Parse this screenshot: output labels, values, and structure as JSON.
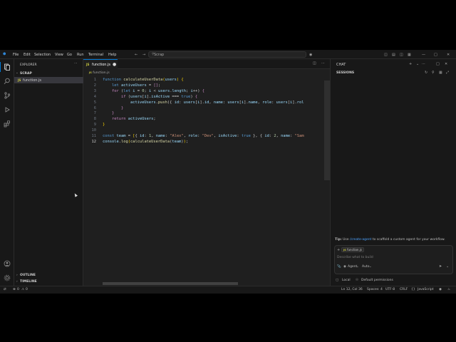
{
  "menu": {
    "file": "File",
    "edit": "Edit",
    "selection": "Selection",
    "view": "View",
    "go": "Go",
    "run": "Run",
    "terminal": "Terminal",
    "help": "Help"
  },
  "search_label": "Scrap",
  "explorer": {
    "title": "EXPLORER",
    "folder": "SCRAP",
    "file": "function.js",
    "outline": "OUTLINE",
    "timeline": "TIMELINE"
  },
  "editor": {
    "tab": "function.js",
    "breadcrumb": "function.js",
    "code_lines": [
      "1",
      "2",
      "3",
      "4",
      "5",
      "6",
      "7",
      "8",
      "9",
      "10",
      "11",
      "12"
    ]
  },
  "chat": {
    "title": "CHAT",
    "sessions": "SESSIONS",
    "tip_label": "Tip:",
    "tip_prefix": "Use",
    "tip_command": "/create-agent",
    "tip_suffix": "to scaffold a custom agent for your workflow.",
    "context_file": "function.js",
    "placeholder": "Describe what to build",
    "agent": "Agent",
    "auto": "Auto",
    "local": "Local",
    "permissions": "Default permissions"
  },
  "status": {
    "errors": "0",
    "warnings": "0",
    "position": "Ln 12, Col 36",
    "spaces": "Spaces: 4",
    "encoding": "UTF-8",
    "eol": "CRLF",
    "language": "JavaScript"
  }
}
